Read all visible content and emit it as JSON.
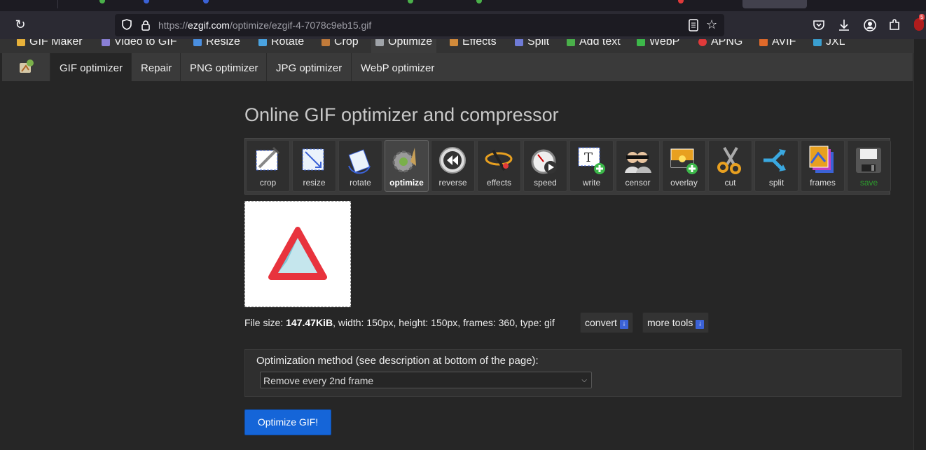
{
  "browser": {
    "url_prefix": "https://",
    "url_domain": "ezgif.com",
    "url_path": "/optimize/ezgif-4-7078c9eb15.gif",
    "badge_count": "5"
  },
  "topnav": {
    "items": [
      {
        "label": "GIF Maker",
        "color": "#e8b23a"
      },
      {
        "label": "Video to GIF",
        "color": "#8a7fd6"
      },
      {
        "label": "Resize",
        "color": "#4a8fe0"
      },
      {
        "label": "Rotate",
        "color": "#4aa3e0"
      },
      {
        "label": "Crop",
        "color": "#c07a3a"
      },
      {
        "label": "Optimize",
        "color": "#9fa3a8"
      },
      {
        "label": "Effects",
        "color": "#d18a3a"
      },
      {
        "label": "Split",
        "color": "#6f7bd6"
      },
      {
        "label": "Add text",
        "color": "#4ab04a"
      },
      {
        "label": "WebP",
        "color": "#3db84a"
      },
      {
        "label": "APNG",
        "color": "#e03a3a"
      },
      {
        "label": "AVIF",
        "color": "#e06a2a"
      },
      {
        "label": "JXL",
        "color": "#3a9fd0"
      }
    ]
  },
  "subnav": {
    "tabs": [
      "GIF optimizer",
      "Repair",
      "PNG optimizer",
      "JPG optimizer",
      "WebP optimizer"
    ]
  },
  "page": {
    "title": "Online GIF optimizer and compressor"
  },
  "tools": [
    {
      "label": "crop",
      "icon": "crop-icon"
    },
    {
      "label": "resize",
      "icon": "resize-icon"
    },
    {
      "label": "rotate",
      "icon": "rotate-icon"
    },
    {
      "label": "optimize",
      "icon": "optimize-icon"
    },
    {
      "label": "reverse",
      "icon": "reverse-icon"
    },
    {
      "label": "effects",
      "icon": "effects-icon"
    },
    {
      "label": "speed",
      "icon": "speed-icon"
    },
    {
      "label": "write",
      "icon": "write-icon"
    },
    {
      "label": "censor",
      "icon": "censor-icon"
    },
    {
      "label": "overlay",
      "icon": "overlay-icon"
    },
    {
      "label": "cut",
      "icon": "cut-icon"
    },
    {
      "label": "split",
      "icon": "split-icon"
    },
    {
      "label": "frames",
      "icon": "frames-icon"
    },
    {
      "label": "save",
      "icon": "save-icon"
    }
  ],
  "fileinfo": {
    "size_label": "File size:",
    "size_value": "147.47KiB",
    "rest": ", width: 150px, height: 150px, frames: 360, type: gif",
    "convert_label": "convert",
    "more_tools_label": "more tools"
  },
  "options": {
    "method_label": "Optimization method (see description at bottom of the page):",
    "method_selected": "Remove every 2nd frame"
  },
  "submit_label": "Optimize GIF!"
}
